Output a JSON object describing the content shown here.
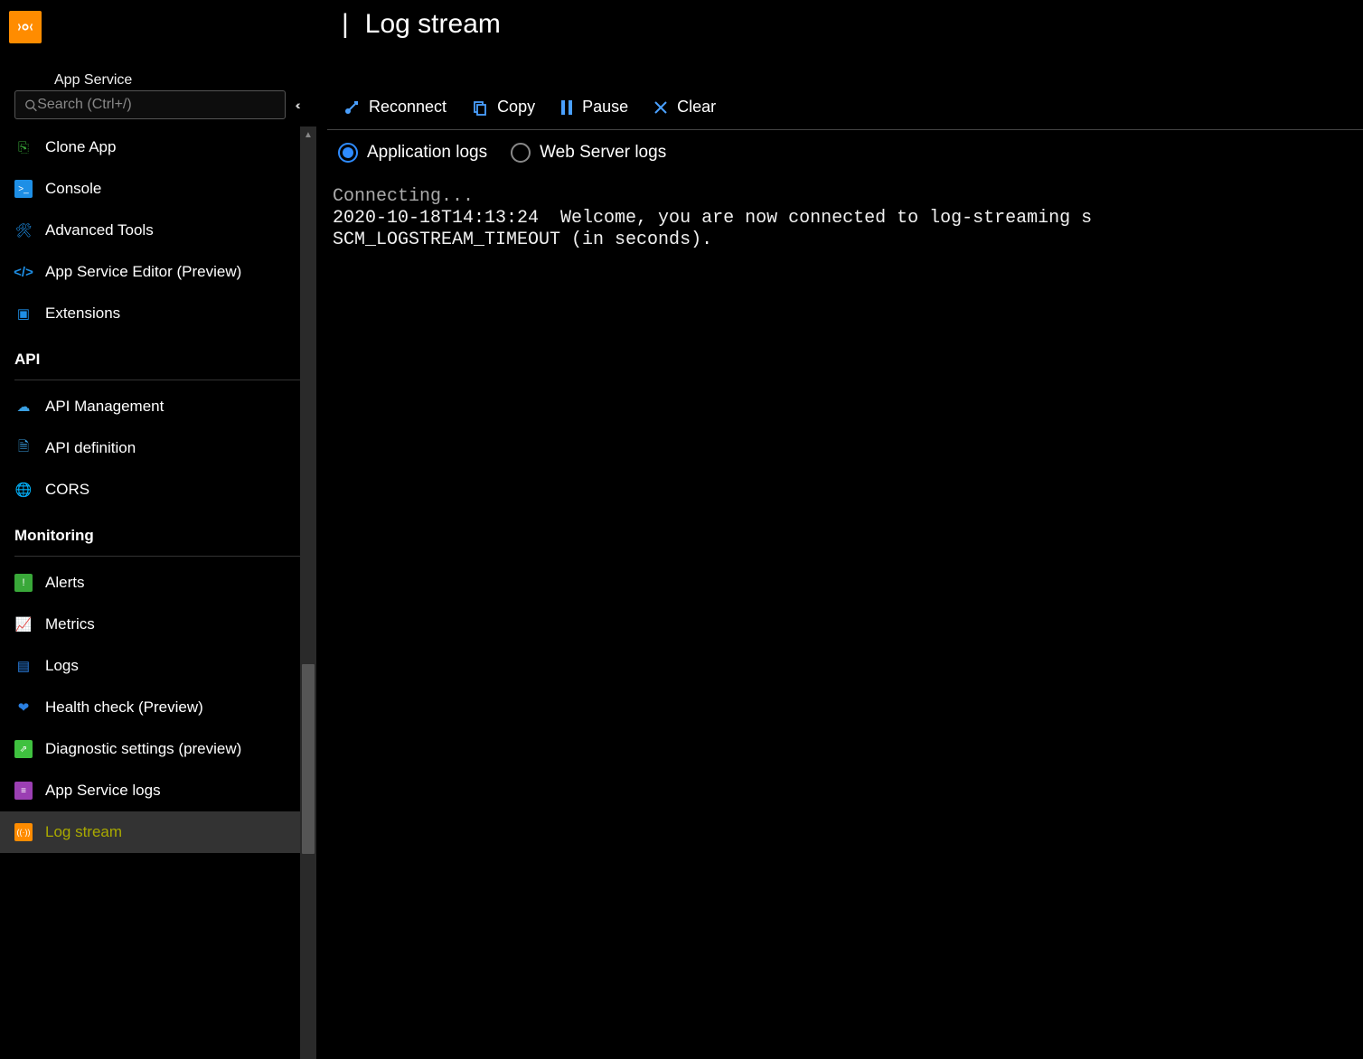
{
  "header": {
    "page_title": "Log stream",
    "subtitle": "App Service"
  },
  "search": {
    "placeholder": "Search (Ctrl+/)"
  },
  "sidebar": {
    "items": [
      {
        "label": "Clone App",
        "icon": "clone-icon",
        "color": "#39a839"
      },
      {
        "label": "Console",
        "icon": "console-icon",
        "color": "#1e8fe6"
      },
      {
        "label": "Advanced Tools",
        "icon": "tools-icon",
        "color": "#1e8fe6"
      },
      {
        "label": "App Service Editor (Preview)",
        "icon": "code-icon",
        "color": "#1e8fe6"
      },
      {
        "label": "Extensions",
        "icon": "extensions-icon",
        "color": "#1e8fe6"
      }
    ],
    "section_api": "API",
    "api_items": [
      {
        "label": "API Management",
        "icon": "cloud-icon",
        "color": "#3aa0e3"
      },
      {
        "label": "API definition",
        "icon": "doc-icon",
        "color": "#3aa0e3"
      },
      {
        "label": "CORS",
        "icon": "globe-icon",
        "color": "#39a839"
      }
    ],
    "section_monitoring": "Monitoring",
    "monitoring_items": [
      {
        "label": "Alerts",
        "icon": "alerts-icon",
        "color": "#39a839"
      },
      {
        "label": "Metrics",
        "icon": "metrics-icon",
        "color": "#3a6fe0"
      },
      {
        "label": "Logs",
        "icon": "logs-icon",
        "color": "#2a7fe0"
      },
      {
        "label": "Health check (Preview)",
        "icon": "health-icon",
        "color": "#2a7fe0"
      },
      {
        "label": "Diagnostic settings (preview)",
        "icon": "diagnostic-icon",
        "color": "#3fc13f"
      },
      {
        "label": "App Service logs",
        "icon": "app-logs-icon",
        "color": "#9b3fb3"
      },
      {
        "label": "Log stream",
        "icon": "log-stream-icon",
        "color": "#ff8c00",
        "selected": true
      }
    ]
  },
  "toolbar": {
    "reconnect": "Reconnect",
    "copy": "Copy",
    "pause": "Pause",
    "clear": "Clear"
  },
  "radios": {
    "app_logs": "Application logs",
    "web_logs": "Web Server logs"
  },
  "log": {
    "line1": "Connecting...",
    "line2": "2020-10-18T14:13:24  Welcome, you are now connected to log-streaming s",
    "line3": "SCM_LOGSTREAM_TIMEOUT (in seconds)."
  }
}
